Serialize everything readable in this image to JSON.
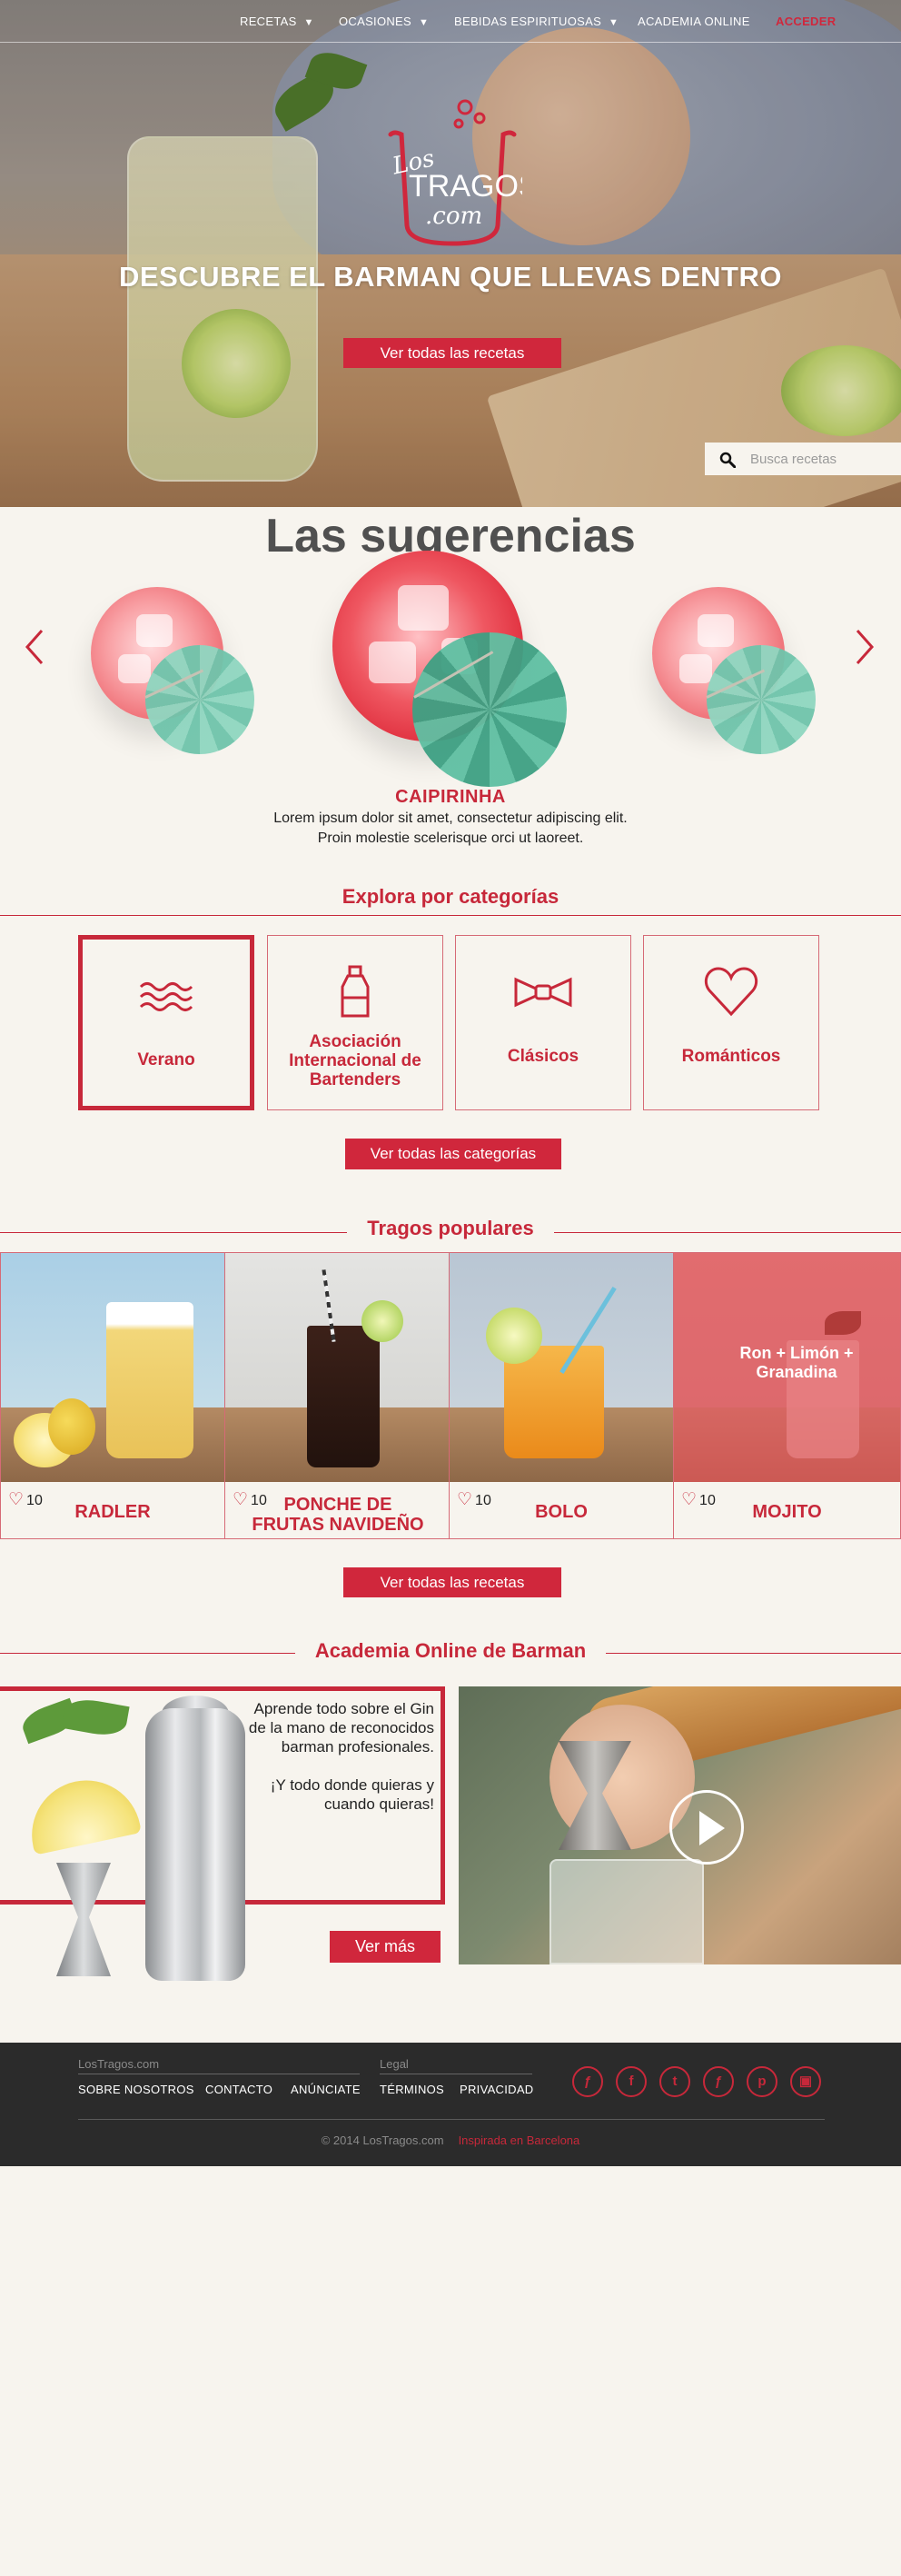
{
  "nav": {
    "items": [
      {
        "label": "RECETAS",
        "has_dropdown": true
      },
      {
        "label": "OCASIONES",
        "has_dropdown": true
      },
      {
        "label": "BEBIDAS ESPIRITUOSAS",
        "has_dropdown": true
      },
      {
        "label": "ACADEMIA ONLINE",
        "has_dropdown": false
      }
    ],
    "login": "ACCEDER"
  },
  "hero": {
    "logo_line1": "Los",
    "logo_line2": "TRAGOS",
    "logo_line3": ".com",
    "title": "DESCUBRE EL BARMAN QUE LLEVAS DENTRO",
    "button": "Ver todas las recetas"
  },
  "search": {
    "placeholder": "Busca recetas"
  },
  "suggestions": {
    "title": "Las sugerencias",
    "featured_name": "CAIPIRINHA",
    "featured_text": "Lorem ipsum dolor sit amet, consectetur adipiscing elit. Proin molestie scelerisque orci ut laoreet."
  },
  "categories": {
    "title": "Explora por categorías",
    "items": [
      {
        "label": "Verano",
        "icon": "waves-icon",
        "active": true
      },
      {
        "label": "Asociación Internacional de Bartenders",
        "icon": "bottle-icon",
        "active": false
      },
      {
        "label": "Clásicos",
        "icon": "bowtie-icon",
        "active": false
      },
      {
        "label": "Románticos",
        "icon": "heart-icon",
        "active": false
      }
    ],
    "button": "Ver todas las categorías"
  },
  "popular": {
    "title": "Tragos populares",
    "items": [
      {
        "name": "RADLER",
        "likes": "10"
      },
      {
        "name": "PONCHE DE FRUTAS NAVIDEÑO",
        "likes": "10"
      },
      {
        "name": "BOLO",
        "likes": "10"
      },
      {
        "name": "MOJITO",
        "likes": "10",
        "overlay": "Ron + Limón + Granadina"
      }
    ],
    "button": "Ver todas las recetas"
  },
  "academy": {
    "title": "Academia Online de Barman",
    "text1": "Aprende todo sobre el Gin de la mano de reconocidos barman profesionales.",
    "text2": "¡Y todo donde quieras y cuando quieras!",
    "button": "Ver más"
  },
  "footer": {
    "group1_title": "LosTragos.com",
    "group1_links": [
      "SOBRE NOSOTROS",
      "CONTACTO",
      "ANÚNCIATE"
    ],
    "group2_title": "Legal",
    "group2_links": [
      "TÉRMINOS",
      "PRIVACIDAD"
    ],
    "social": [
      "foursquare-icon",
      "facebook-icon",
      "twitter-icon",
      "foursquare-alt-icon",
      "pinterest-icon",
      "instagram-icon"
    ],
    "copyright": "© 2014 LosTragos.com",
    "tagline": "Inspirada en Barcelona"
  },
  "colors": {
    "accent": "#c7283a",
    "background": "#f7f4ee",
    "footer": "#2b2b2b"
  }
}
